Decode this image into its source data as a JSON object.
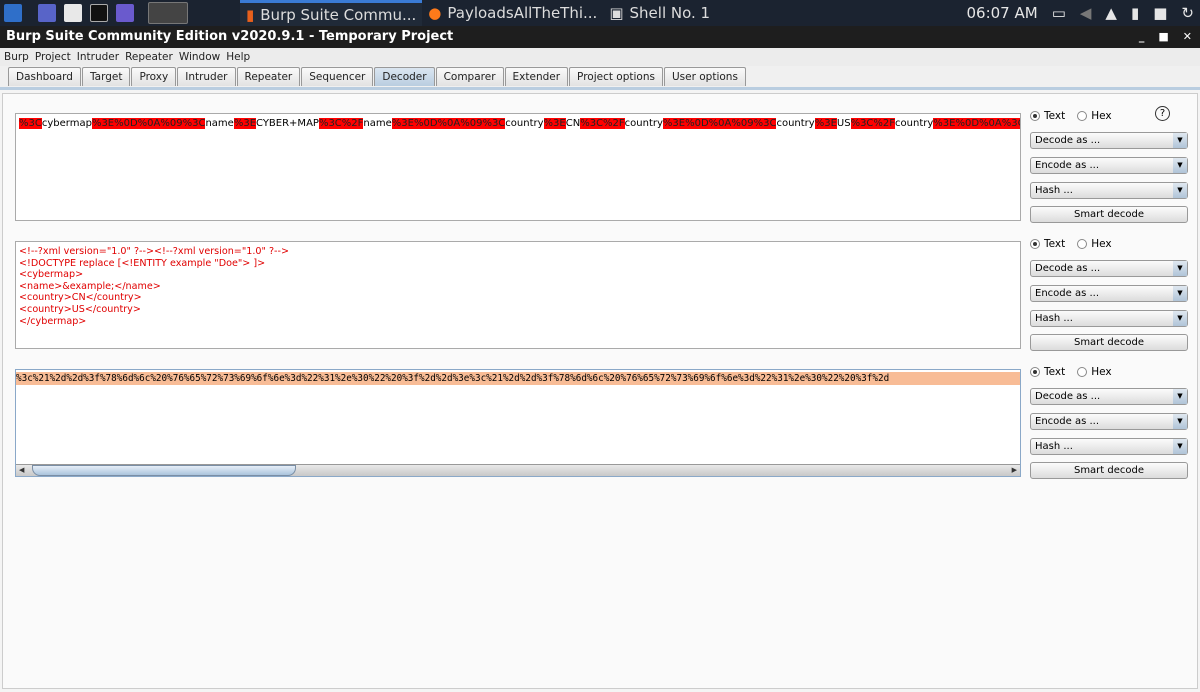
{
  "taskbar": {
    "windows": [
      "Burp Suite Commu...",
      "PayloadsAllTheThi...",
      "Shell No. 1"
    ],
    "clock": "06:07 AM"
  },
  "window": {
    "title": "Burp Suite Community Edition v2020.9.1 - Temporary Project"
  },
  "menu": [
    "Burp",
    "Project",
    "Intruder",
    "Repeater",
    "Window",
    "Help"
  ],
  "tabs": [
    "Dashboard",
    "Target",
    "Proxy",
    "Intruder",
    "Repeater",
    "Sequencer",
    "Decoder",
    "Comparer",
    "Extender",
    "Project options",
    "User options"
  ],
  "active_tab": "Decoder",
  "panel1": {
    "segments": [
      "%3C",
      "cybermap",
      "%3E%0D%0A%09%3C",
      "name",
      "%3E",
      "CYBER+MAP",
      "%3C%2F",
      "name",
      "%3E%0D%0A%09%3C",
      "country",
      "%3E",
      "CN",
      "%3C%2F",
      "country",
      "%3E%0D%0A%09%3C",
      "country",
      "%3E",
      "US",
      "%3C%2F",
      "country",
      "%3E%0D%0A%3C%2F",
      "cybermap",
      "%3E"
    ]
  },
  "panel2": {
    "lines": [
      "<!--?xml version=\"1.0\" ?--><!--?xml version=\"1.0\" ?-->",
      "<!DOCTYPE replace [<!ENTITY example \"Doe\"> ]>",
      "<cybermap>",
      "<name>&example;</name>",
      "<country>CN</country>",
      "<country>US</country>",
      "</cybermap>"
    ]
  },
  "panel3": {
    "text": "%3c%21%2d%2d%3f%78%6d%6c%20%76%65%72%73%69%6f%6e%3d%22%31%2e%30%22%20%3f%2d%2d%3e%3c%21%2d%2d%3f%78%6d%6c%20%76%65%72%73%69%6f%6e%3d%22%31%2e%30%22%20%3f%2d"
  },
  "controls": {
    "text_label": "Text",
    "hex_label": "Hex",
    "help": "?",
    "decode": "Decode as ...",
    "encode": "Encode as ...",
    "hash": "Hash ...",
    "smart": "Smart decode"
  },
  "colors": {
    "highlight": "#ff0000",
    "selection": "#f8bc96",
    "decoded_text": "#e00000"
  }
}
